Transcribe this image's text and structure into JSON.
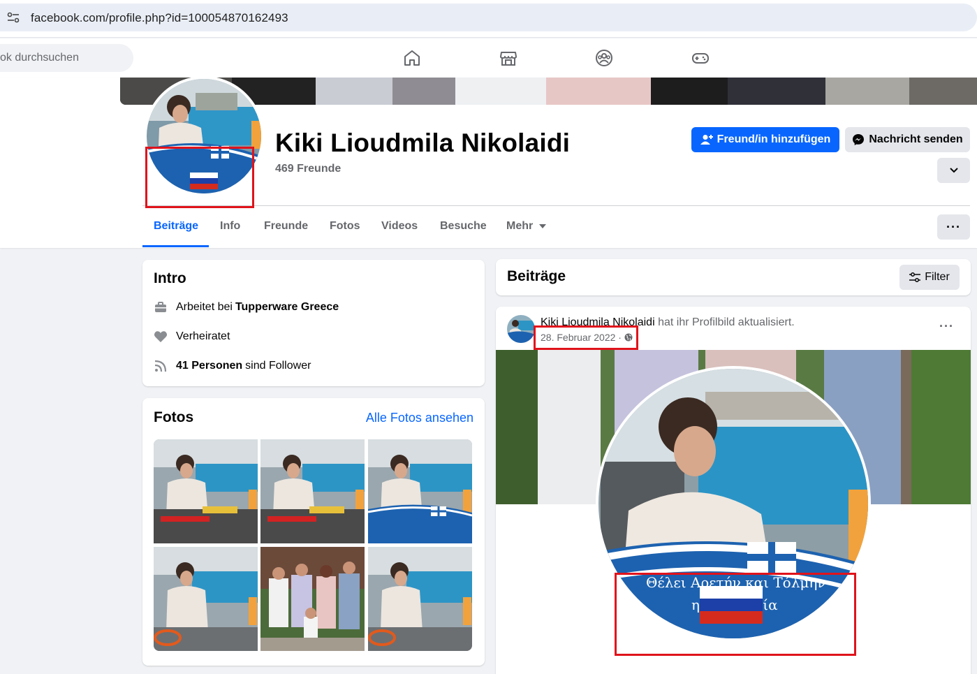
{
  "browser": {
    "url": "facebook.com/profile.php?id=100054870162493"
  },
  "topnav": {
    "search_placeholder": "ok durchsuchen",
    "icons": [
      "home-icon",
      "marketplace-icon",
      "groups-icon",
      "gaming-icon"
    ]
  },
  "profile": {
    "name": "Kiki Lioudmila Nikolaidi",
    "friends_count": "469 Freunde",
    "add_friend_label": "Freund/in hinzufügen",
    "message_label": "Nachricht senden"
  },
  "tabs": [
    {
      "label": "Beiträge",
      "active": true
    },
    {
      "label": "Info"
    },
    {
      "label": "Freunde"
    },
    {
      "label": "Fotos"
    },
    {
      "label": "Videos"
    },
    {
      "label": "Besuche"
    },
    {
      "label": "Mehr"
    }
  ],
  "intro": {
    "title": "Intro",
    "work_prefix": "Arbeitet bei",
    "work_company": "Tupperware Greece",
    "relationship": "Verheiratet",
    "followers_bold": "41 Personen",
    "followers_suffix": "sind Follower"
  },
  "photos": {
    "title": "Fotos",
    "see_all": "Alle Fotos ansehen"
  },
  "posts": {
    "title": "Beiträge",
    "filter_label": "Filter",
    "post": {
      "author": "Kiki Lioudmila Nikolaidi",
      "action": "hat ihr Profilbild aktualisiert.",
      "date": "28. Februar 2022 ·",
      "banner_text": "Θέλει Αρετήν και Τόλμην",
      "banner_text_2": "η Ελευθερία"
    }
  },
  "colors": {
    "accent": "#0866ff",
    "highlight_box": "#e0131b",
    "greek_blue": "#1a5fb4",
    "russian_red": "#d52b1e"
  }
}
